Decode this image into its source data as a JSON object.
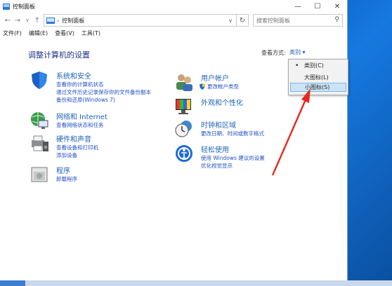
{
  "window": {
    "title": "控制面板"
  },
  "window_controls": {
    "minimize": "—",
    "maximize": "☐",
    "close": "✕"
  },
  "nav": {
    "back": "←",
    "forward": "→",
    "up": "↑"
  },
  "address": {
    "crumb": "控制面板",
    "chevron": "∨"
  },
  "refresh": "↻",
  "search": {
    "placeholder": "搜索控制面板"
  },
  "menu": [
    "文件(F)",
    "编辑(E)",
    "查看(V)",
    "工具(T)"
  ],
  "heading": "调整计算机的设置",
  "view_by": {
    "label": "查看方式:",
    "value": "类别 ▾"
  },
  "dropdown": {
    "items": [
      {
        "label": "类别(C)",
        "marker": "•"
      },
      {
        "label": "大图标(L)",
        "marker": ""
      },
      {
        "label": "小图标(S)",
        "marker": ""
      }
    ]
  },
  "categories_left": [
    {
      "title": "系统和安全",
      "links": [
        "查看你的计算机状态",
        "通过文件历史记录保存你的文件备份副本",
        "备份和还原(Windows 7)"
      ]
    },
    {
      "title": "网络和 Internet",
      "links": [
        "查看网络状态和任务"
      ]
    },
    {
      "title": "硬件和声音",
      "links": [
        "查看设备和打印机",
        "添加设备"
      ]
    },
    {
      "title": "程序",
      "links": [
        "卸载程序"
      ]
    }
  ],
  "categories_right": [
    {
      "title": "用户帐户",
      "links": [
        "更改帐户类型"
      ]
    },
    {
      "title": "外观和个性化",
      "links": []
    },
    {
      "title": "时钟和区域",
      "links": [
        "更改日期、时间或数字格式"
      ]
    },
    {
      "title": "轻松使用",
      "links": [
        "使用 Windows 建议的设置",
        "优化视觉显示"
      ]
    }
  ],
  "colors": {
    "link": "#1f4ec8",
    "title": "#1e64b4",
    "heading": "#1e3287",
    "annotation_arrow": "#e8281e"
  }
}
